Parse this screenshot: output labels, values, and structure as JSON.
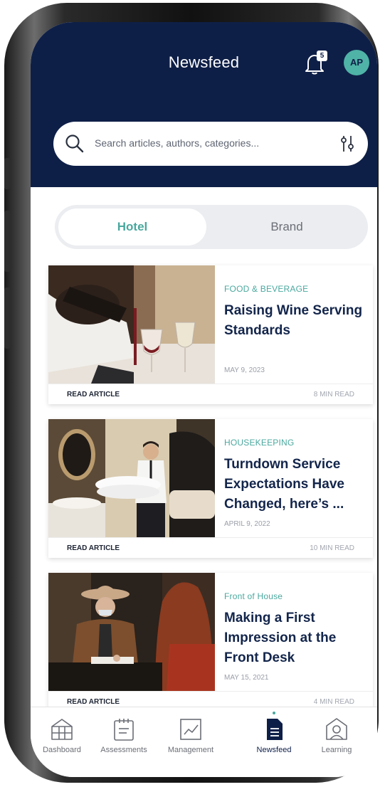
{
  "header": {
    "title": "Newsfeed",
    "notification_count": "5",
    "avatar_initials": "AP"
  },
  "search": {
    "placeholder": "Search articles, authors, categories..."
  },
  "tabs": [
    {
      "label": "Hotel",
      "active": true
    },
    {
      "label": "Brand",
      "active": false
    }
  ],
  "articles": [
    {
      "category": "FOOD & BEVERAGE",
      "title": "Raising Wine Serving Standards",
      "date": "MAY 9, 2023",
      "read_label": "READ ARTICLE",
      "read_time": "8 MIN READ"
    },
    {
      "category": "HOUSEKEEPING",
      "title": "Turndown Service Expectations Have Changed, here’s ...",
      "date": "APRIL 9, 2022",
      "read_label": "READ ARTICLE",
      "read_time": "10 MIN READ"
    },
    {
      "category": "Front of House",
      "title": "Making a First Impression at the Front Desk",
      "date": "MAY 15, 2021",
      "read_label": "READ ARTICLE",
      "read_time": "4 MIN READ"
    }
  ],
  "nav": [
    {
      "label": "Dashboard",
      "icon": "dashboard-icon"
    },
    {
      "label": "Assessments",
      "icon": "assessments-icon"
    },
    {
      "label": "Management",
      "icon": "management-icon"
    },
    {
      "label": "Newsfeed",
      "icon": "newsfeed-icon",
      "active": true
    },
    {
      "label": "Learning",
      "icon": "learning-icon"
    }
  ],
  "colors": {
    "header_bg": "#0e1f47",
    "accent": "#4aa89e",
    "title_text": "#13254b"
  }
}
